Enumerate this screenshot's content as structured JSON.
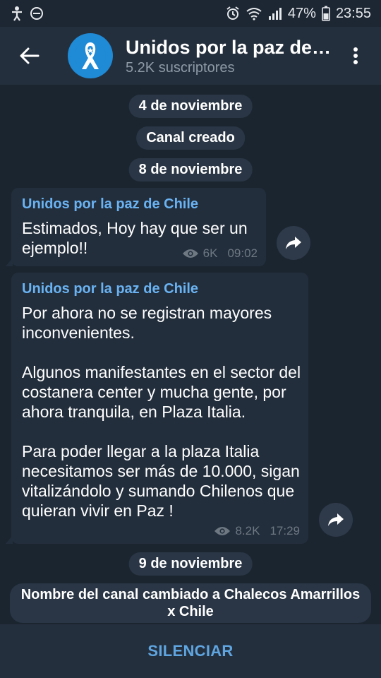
{
  "status_bar": {
    "battery": "47%",
    "time": "23:55"
  },
  "header": {
    "title": "Unidos por la paz de C...",
    "subscribers": "5.2K suscriptores"
  },
  "messages": [
    {
      "type": "date",
      "text": "4 de noviembre"
    },
    {
      "type": "service",
      "text": "Canal creado"
    },
    {
      "type": "date",
      "text": "8 de noviembre"
    },
    {
      "type": "post",
      "sender": "Unidos por la paz de Chile",
      "text": "Estimados, Hoy hay que ser un ejemplo!!",
      "views": "6K",
      "time": "09:02"
    },
    {
      "type": "post",
      "sender": "Unidos por la paz de Chile",
      "text": "Por ahora no se registran mayores inconvenientes.\n\nAlgunos manifestantes en el sector del costanera center y mucha gente, por ahora tranquila, en Plaza Italia.\n\nPara poder llegar a la plaza Italia necesitamos ser más de 10.000, sigan vitalizándolo y sumando Chilenos que quieran vivir en Paz !",
      "views": "8.2K",
      "time": "17:29"
    },
    {
      "type": "date",
      "text": "9 de noviembre"
    },
    {
      "type": "service",
      "text": "Nombre del canal cambiado a Chalecos Amarrillos x Chile"
    }
  ],
  "bottom": {
    "mute_label": "SILENCIAR"
  },
  "colors": {
    "background": "#1b2530",
    "header": "#242f3d",
    "bubble": "#232e3c",
    "accent": "#6ab3f3"
  }
}
